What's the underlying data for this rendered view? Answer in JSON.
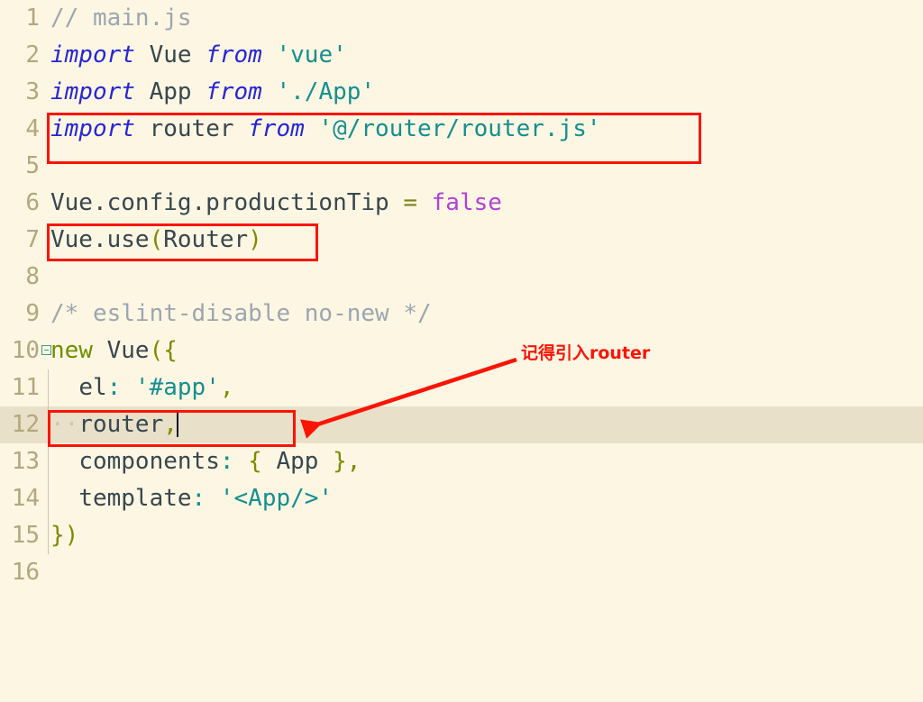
{
  "editor": {
    "background_color": "#fdf6e3",
    "current_line_color": "#e8e0c8",
    "gutter_number_color": "#b3a77c",
    "annotation_color": "#fb1405",
    "lines": [
      {
        "number": "1",
        "current": false,
        "fold": false,
        "guide": false
      },
      {
        "number": "2",
        "current": false,
        "fold": false,
        "guide": false
      },
      {
        "number": "3",
        "current": false,
        "fold": false,
        "guide": false
      },
      {
        "number": "4",
        "current": false,
        "fold": false,
        "guide": false
      },
      {
        "number": "5",
        "current": false,
        "fold": false,
        "guide": false
      },
      {
        "number": "6",
        "current": false,
        "fold": false,
        "guide": false
      },
      {
        "number": "7",
        "current": false,
        "fold": false,
        "guide": false
      },
      {
        "number": "8",
        "current": false,
        "fold": false,
        "guide": false
      },
      {
        "number": "9",
        "current": false,
        "fold": false,
        "guide": false
      },
      {
        "number": "10",
        "current": false,
        "fold": true,
        "guide": false
      },
      {
        "number": "11",
        "current": false,
        "fold": false,
        "guide": true
      },
      {
        "number": "12",
        "current": true,
        "fold": false,
        "guide": true
      },
      {
        "number": "13",
        "current": false,
        "fold": false,
        "guide": true
      },
      {
        "number": "14",
        "current": false,
        "fold": false,
        "guide": true
      },
      {
        "number": "15",
        "current": false,
        "fold": false,
        "guide": true
      },
      {
        "number": "16",
        "current": false,
        "fold": false,
        "guide": true
      }
    ],
    "source_text": [
      "// main.js",
      "import Vue from 'vue'",
      "import App from './App'",
      "import router from '@/router/router.js'",
      "",
      "Vue.config.productionTip = false",
      "Vue.use(Router)",
      "",
      "/* eslint-disable no-new */",
      "new Vue({",
      "  el: '#app',",
      "  router,",
      "  components: { App },",
      "  template: '<App/>'",
      "})",
      ""
    ],
    "tokens": {
      "line1": {
        "comment": "// main.js"
      },
      "line2": {
        "kw": "import",
        "ident": " Vue ",
        "kw2": "from",
        "str": " 'vue'"
      },
      "line3": {
        "kw": "import",
        "ident": " App ",
        "kw2": "from",
        "str": " './App'"
      },
      "line4": {
        "kw": "import",
        "ident": " router ",
        "kw2": "from",
        "str": " '@/router/router.js'"
      },
      "line6": {
        "ident": "Vue.config.productionTip ",
        "op": "=",
        "const": " false"
      },
      "line7": {
        "ident": "Vue.use",
        "p1": "(",
        "arg": "Router",
        "p2": ")"
      },
      "line9": {
        "comment": "/* eslint-disable no-new */"
      },
      "line10": {
        "kw": "new",
        "ident": " Vue",
        "p": "({"
      },
      "line11": {
        "indent": "  ",
        "prop": "el",
        "colon": ":",
        "str": " '#app'",
        "comma": ","
      },
      "line12": {
        "indent": "  ",
        "prop": "router",
        "comma": ","
      },
      "line13": {
        "indent": "  ",
        "prop": "components",
        "colon": ":",
        "b1": " { ",
        "arg": "App",
        "b2": " }",
        "comma": ","
      },
      "line14": {
        "indent": "  ",
        "prop": "template",
        "colon": ":",
        "str": " '<App/>'"
      },
      "line15": {
        "b": "})"
      }
    }
  },
  "annotations": {
    "boxes": [
      {
        "name": "highlight-box-import-router",
        "label": "import router from '@/router/router.js'"
      },
      {
        "name": "highlight-box-vue-use-router",
        "label": "Vue.use(Router)"
      },
      {
        "name": "highlight-box-router-property",
        "label": "router,"
      }
    ],
    "arrow_label": "记得引入router"
  }
}
